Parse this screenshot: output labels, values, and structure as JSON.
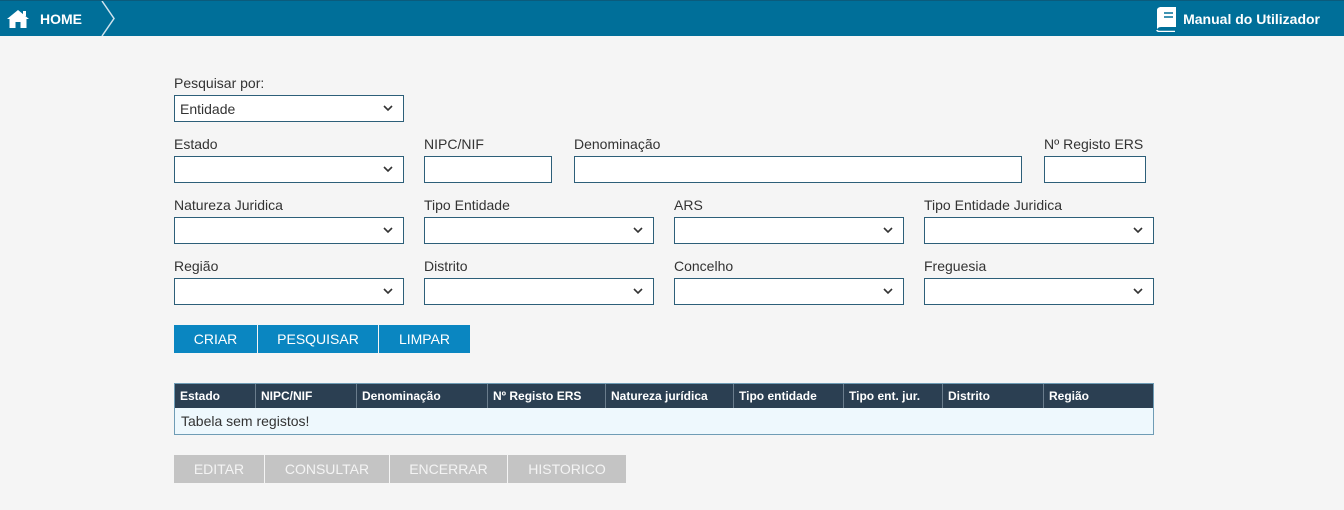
{
  "header": {
    "home_label": "HOME",
    "manual_label": "Manual do Utilizador"
  },
  "search": {
    "search_by_label": "Pesquisar por:",
    "search_by_value": "Entidade"
  },
  "filters": {
    "estado": {
      "label": "Estado",
      "value": ""
    },
    "nipc": {
      "label": "NIPC/NIF",
      "value": ""
    },
    "denominacao": {
      "label": "Denominação",
      "value": ""
    },
    "registo_ers": {
      "label": "Nº Registo ERS",
      "value": ""
    },
    "natureza_juridica": {
      "label": "Natureza Juridica",
      "value": ""
    },
    "tipo_entidade": {
      "label": "Tipo Entidade",
      "value": ""
    },
    "ars": {
      "label": "ARS",
      "value": ""
    },
    "tipo_entidade_juridica": {
      "label": "Tipo Entidade Juridica",
      "value": ""
    },
    "regiao": {
      "label": "Região",
      "value": ""
    },
    "distrito": {
      "label": "Distrito",
      "value": ""
    },
    "concelho": {
      "label": "Concelho",
      "value": ""
    },
    "freguesia": {
      "label": "Freguesia",
      "value": ""
    }
  },
  "actions": {
    "criar": "CRIAR",
    "pesquisar": "PESQUISAR",
    "limpar": "LIMPAR"
  },
  "table": {
    "columns": [
      "Estado",
      "NIPC/NIF",
      "Denominação",
      "Nº Registo ERS",
      "Natureza jurídica",
      "Tipo entidade",
      "Tipo ent. jur.",
      "Distrito",
      "Região"
    ],
    "empty_message": "Tabela sem registos!"
  },
  "row_actions": {
    "editar": "EDITAR",
    "consultar": "CONSULTAR",
    "encerrar": "ENCERRAR",
    "historico": "HISTORICO"
  },
  "colors": {
    "header_bg": "#006f99",
    "primary_button": "#0a86c1",
    "disabled_button": "#c4c4c4",
    "table_header": "#2b3f52"
  }
}
